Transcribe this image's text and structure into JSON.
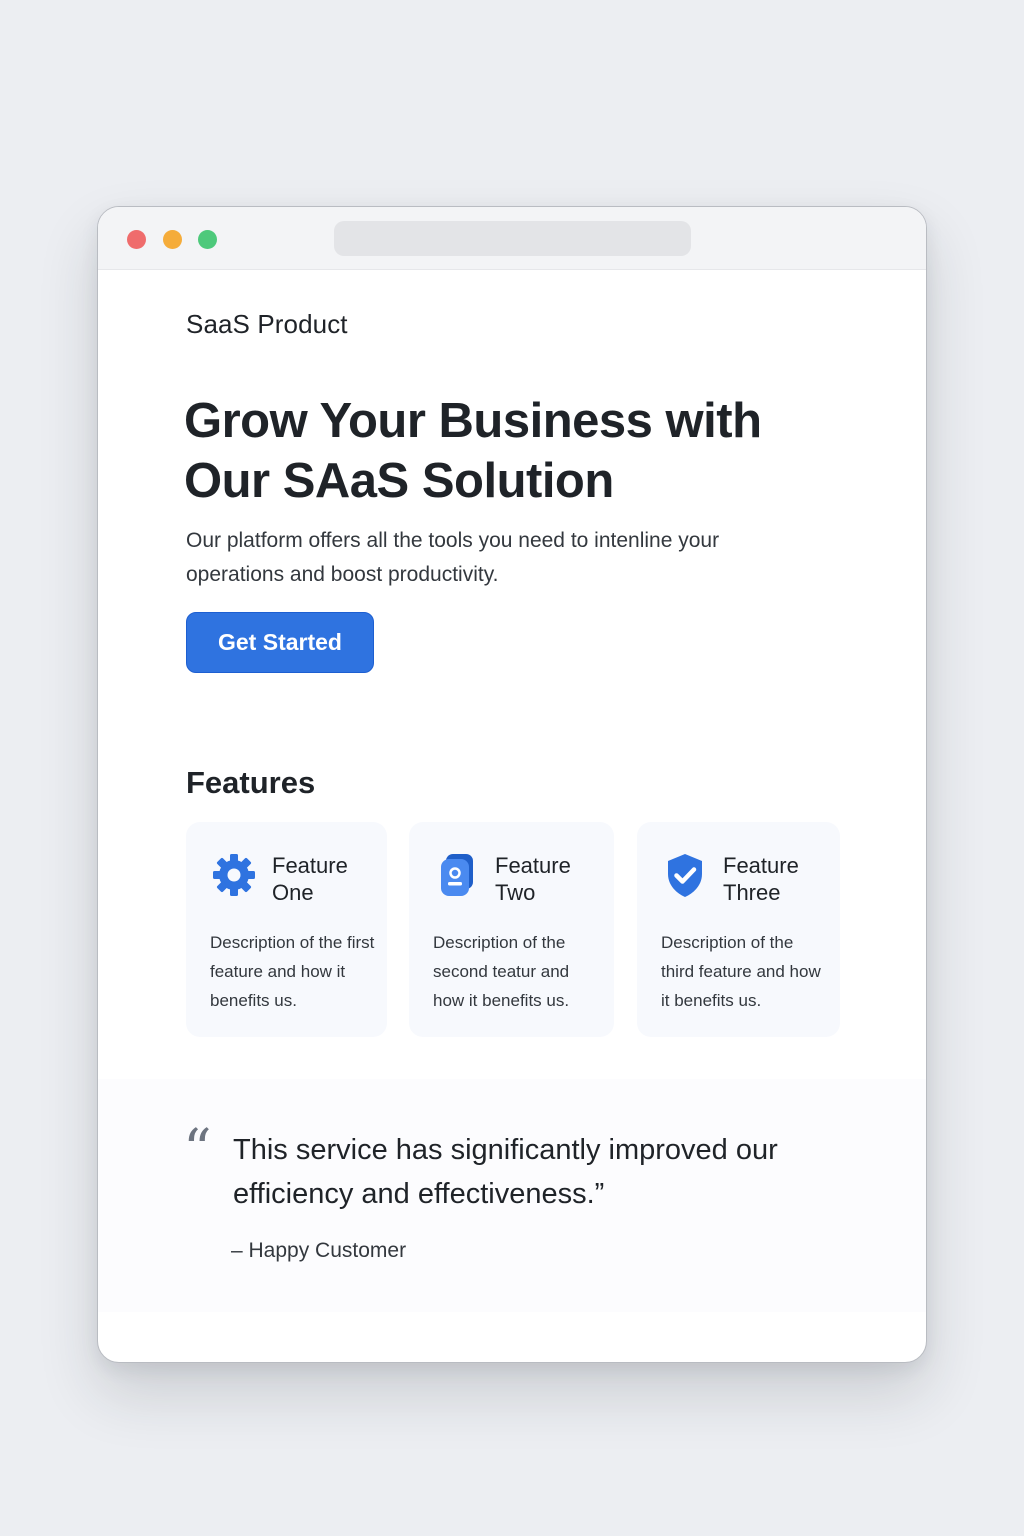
{
  "brand": {
    "name": "SaaS Product"
  },
  "hero": {
    "title": "Grow Your Business with Our SAaS Solution",
    "text": "Our platform offers all the tools you need to intenline your operations and boost productivity.",
    "cta_label": "Get Started"
  },
  "features": {
    "title": "Features",
    "items": [
      {
        "icon": "gear-icon",
        "title": "Feature One",
        "description": "Description of the first feature and how it benefits us."
      },
      {
        "icon": "document-icon",
        "title": "Feature Two",
        "description": "Description of the second teatur and how it benefits us."
      },
      {
        "icon": "shield-check-icon",
        "title": "Feature Three",
        "description": "Description of the third feature and how it benefits us."
      }
    ]
  },
  "testimonial": {
    "quote_mark": "“",
    "quote": "This service has significantly improved our efficiency and effectiveness.”",
    "author": "– Happy Customer"
  },
  "colors": {
    "accent": "#2f73e0",
    "page_background": "#eceef2",
    "window_close": "#ef6c6c",
    "window_minimize": "#f5ac3a",
    "window_maximize": "#4dc97b"
  }
}
